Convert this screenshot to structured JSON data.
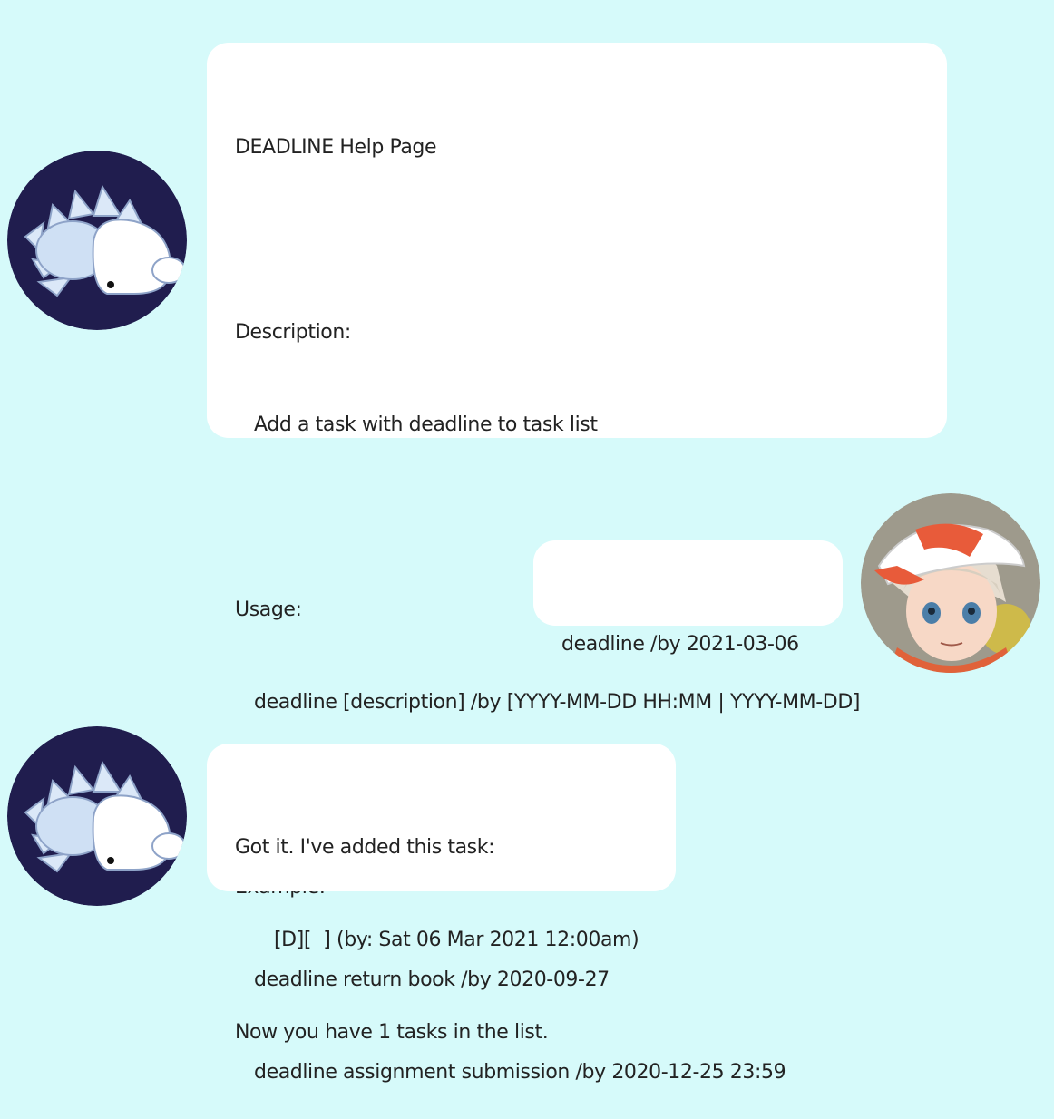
{
  "messages": [
    {
      "sender": "bot",
      "lines": [
        "DEADLINE Help Page",
        "",
        "Description:",
        "Add a task with deadline to task list",
        "",
        "Usage:",
        "deadline [description] /by [YYYY-MM-DD HH:MM | YYYY-MM-DD]",
        "",
        "Example:",
        "deadline return book /by 2020-09-27",
        "deadline assignment submission /by 2020-12-25 23:59"
      ]
    },
    {
      "sender": "user",
      "lines": [
        "deadline /by 2021-03-06"
      ]
    },
    {
      "sender": "bot",
      "lines": [
        "Got it. I've added this task:",
        "[D][  ] (by: Sat 06 Mar 2021 12:00am)",
        "Now you have 1 tasks in the list."
      ]
    }
  ],
  "avatars": {
    "bot": {
      "icon": "snom-icon",
      "background": "#201d4e"
    },
    "user": {
      "icon": "trainer-icon",
      "background": "#9e9a8c"
    }
  },
  "colors": {
    "background": "#d6fafa",
    "bubble": "#ffffff",
    "text": "#222222"
  }
}
